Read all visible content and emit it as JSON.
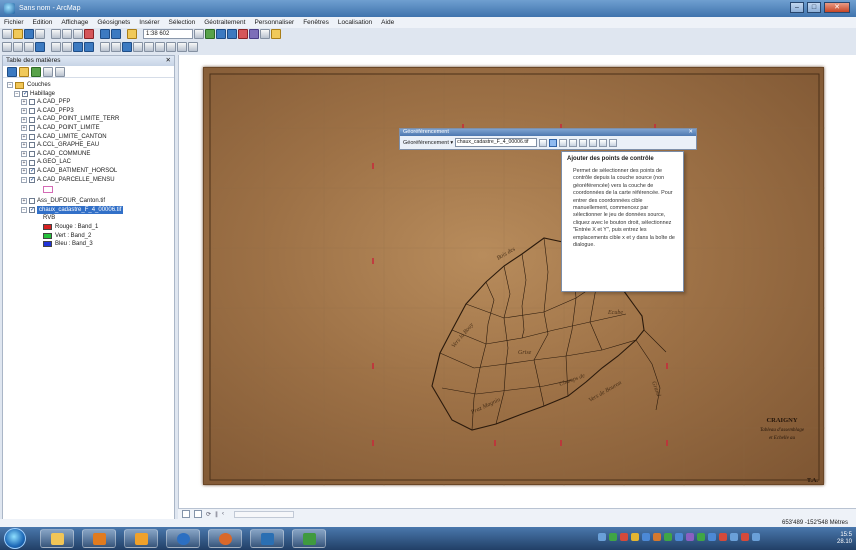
{
  "window": {
    "title": "Sans nom - ArcMap",
    "controls": [
      "–",
      "□",
      "✕"
    ]
  },
  "menu": [
    "Fichier",
    "Edition",
    "Affichage",
    "Géosignets",
    "Insérer",
    "Sélection",
    "Géotraitement",
    "Personnaliser",
    "Fenêtres",
    "Localisation",
    "Aide"
  ],
  "toolbar": {
    "scale": "1:38 602"
  },
  "toc": {
    "title": "Table des matières",
    "close_label": "✕",
    "root": "Couches",
    "group": "Habillage",
    "layers": [
      {
        "name": "A.CAD_PFP",
        "checked": false
      },
      {
        "name": "A.CAD_PFP3",
        "checked": false
      },
      {
        "name": "A.CAD_POINT_LIMITE_TERR",
        "checked": false
      },
      {
        "name": "A.CAD_POINT_LIMITE",
        "checked": false
      },
      {
        "name": "A.CAD_LIMITE_CANTON",
        "checked": false
      },
      {
        "name": "A.CCL_GRAPHE_EAU",
        "checked": false
      },
      {
        "name": "A.CAD_COMMUNE",
        "checked": false
      },
      {
        "name": "A.GEO_LAC",
        "checked": false
      },
      {
        "name": "A.CAD_BATIMENT_HORSOL",
        "checked": true
      },
      {
        "name": "A.CAD_PARCELLE_MENSU",
        "checked": true
      }
    ],
    "raster1": "Ass_DUFOUR_Canton.tif",
    "raster2": "chaux_cadastre_F_4_00006.tif",
    "rgb": "RVB",
    "bands": [
      {
        "label": "Rouge : Band_1",
        "color": "#d62020"
      },
      {
        "label": "Vert : Band_2",
        "color": "#24c13a"
      },
      {
        "label": "Bleu : Band_3",
        "color": "#2033d8"
      }
    ]
  },
  "georef": {
    "title": "Géoréférencement",
    "close_label": "✕",
    "menu_label": "Géoréférencement ▾",
    "layer": "chaux_cadastre_F_4_00006.tif"
  },
  "tooltip": {
    "title": "Ajouter des points de contrôle",
    "body": "Permet de sélectionner des points de contrôle depuis la couche source (non géoréférencée) vers la couche de coordonnées de la carte référencée. Pour entrer des coordonnées cible manuellement, commencez par sélectionner le jeu de données source, cliquez avec le bouton droit, sélectionnez \"Entrée X et Y\", puis entrez les emplacements cible x et y dans la boîte de dialogue."
  },
  "map": {
    "title": "CRAIGNY",
    "subtitle": "Tableau d'assemblage",
    "line3": "et Echelle au",
    "corner_label": "T.A."
  },
  "status": {
    "coords": "653'489 -152'548 Mètres"
  },
  "clock": {
    "time": "15:5",
    "date": "28.10"
  }
}
